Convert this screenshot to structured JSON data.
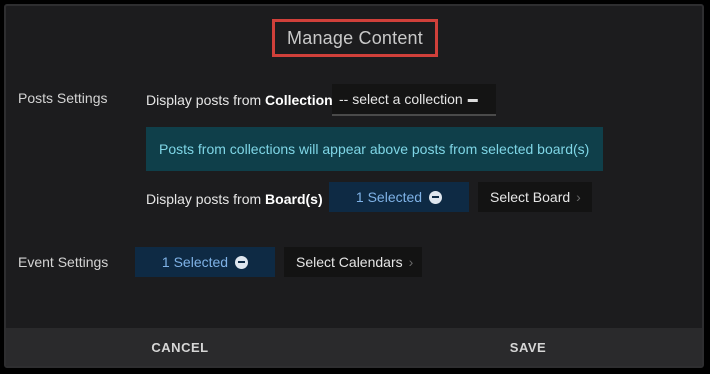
{
  "modal": {
    "title": "Manage Content"
  },
  "posts": {
    "section_label": "Posts Settings",
    "collection_prefix": "Display posts from ",
    "collection_bold": "Collection",
    "collection_select_value": "-- select a collection",
    "info_text": "Posts from collections will appear above posts from selected board(s)",
    "board_prefix": "Display posts from ",
    "board_bold": "Board(s)",
    "board_selected": "1 Selected",
    "select_board_label": "Select Board"
  },
  "events": {
    "section_label": "Event Settings",
    "selected": "1 Selected",
    "select_calendars_label": "Select Calendars"
  },
  "footer": {
    "cancel_label": "CANCEL",
    "save_label": "SAVE"
  },
  "colors": {
    "accent_border": "#d0403a",
    "info_bg": "#0f3f4a",
    "info_text": "#7fd6e6",
    "pill_bg": "#0e2a44"
  }
}
